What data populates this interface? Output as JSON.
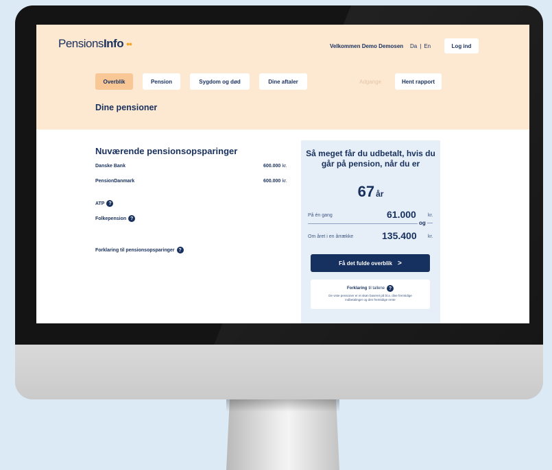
{
  "header": {
    "logo_main": "Pensions",
    "logo_bold": "Info",
    "logo_dots": "••",
    "welcome": "Velkommen Demo Demosen",
    "lang_da": "Da",
    "lang_sep": "|",
    "lang_en": "En",
    "login": "Log ind"
  },
  "nav": {
    "items": [
      {
        "label": "Overblik"
      },
      {
        "label": "Pension"
      },
      {
        "label": "Sygdom og død"
      },
      {
        "label": "Dine aftaler"
      },
      {
        "label": "Adgange"
      },
      {
        "label": "Hent rapport"
      }
    ]
  },
  "page": {
    "title": "Dine pensioner"
  },
  "savings": {
    "title": "Nuværende pensionsopsparinger",
    "rows": [
      {
        "label": "Danske Bank",
        "value": "600.000",
        "unit": "kr."
      },
      {
        "label": "PensionDanmark",
        "value": "600.000",
        "unit": "kr."
      }
    ],
    "atp": "ATP",
    "folkepension": "Folkepension",
    "explain_link": "Forklaring til pensionsopsparinger",
    "help_glyph": "?"
  },
  "panel": {
    "heading": "Så meget får du udbetalt, hvis du går på pension, når du er",
    "age": "67",
    "age_unit": "år",
    "lump_label": "På én gang",
    "lump_value": "61.000",
    "lump_unit": "kr.",
    "og": "og",
    "annual_label": "Om året i en årrække",
    "annual_value": "135.400",
    "annual_unit": "kr.",
    "overview_btn": "Få det fulde overblik",
    "overview_chev": ">",
    "explain_bold": "Forklaring",
    "explain_rest": "til tallene",
    "explain_body": "De viste pensioner er et skøn baseret på bl.a. dine fremtidige indbetalinger og den fremtidige rente"
  },
  "colors": {
    "header_bg": "#fde8d1",
    "navy": "#18305d",
    "active_tab": "#f8c795",
    "panel_bg": "#e6eef8",
    "accent_dots": "#f2a72c"
  }
}
